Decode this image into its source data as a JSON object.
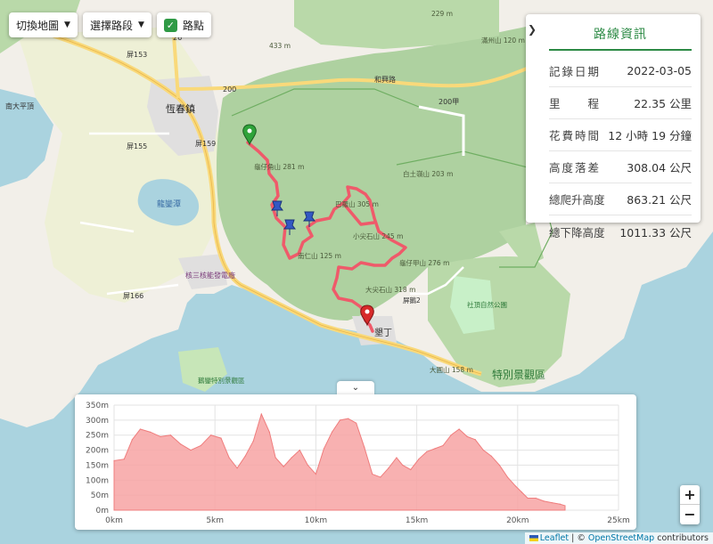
{
  "controls": {
    "switch_map": "切換地圖",
    "select_section": "選擇路段",
    "waypoint": "路點"
  },
  "info": {
    "title": "路線資訊",
    "rows": [
      {
        "label": [
          "記",
          "錄",
          "日",
          "期"
        ],
        "value": "2022-03-05"
      },
      {
        "label": [
          "里",
          "程"
        ],
        "value": "22.35 公里"
      },
      {
        "label": [
          "花",
          "費",
          "時",
          "間"
        ],
        "value": "12 小時 19 分鐘"
      },
      {
        "label": [
          "高",
          "度",
          "落",
          "差"
        ],
        "value": "308.04 公尺"
      },
      {
        "label": [
          "總",
          "爬",
          "升",
          "高",
          "度"
        ],
        "value": "863.21 公尺"
      },
      {
        "label": [
          "總",
          "下",
          "降",
          "高",
          "度"
        ],
        "value": "1011.33 公尺"
      }
    ]
  },
  "map_labels": {
    "towns": [
      "恆春鎮",
      "墾丁"
    ],
    "roads": [
      "屏153",
      "屏155",
      "屏159",
      "屏166",
      "屏174",
      "200",
      "200甲",
      "26",
      "和興路"
    ],
    "peaks": [
      "龜仔角山 281 m",
      "白土嶺山 203 m",
      "巴羅山 305 m",
      "小尖石山 245 m",
      "龜仔甲山 276 m",
      "大尖石山 318 m",
      "南仁山 125 m",
      "大圓山 158 m",
      "滿州山 120 m",
      "229 m",
      "433 m"
    ],
    "places": [
      "核三核能發電廠",
      "鵝鑾特別景觀區",
      "特別景觀區",
      "龍磐坑",
      "社頂自然公園",
      "南大平頂",
      "屏鵝2"
    ],
    "water": [
      "龍鑾潭"
    ]
  },
  "chart_data": {
    "type": "area",
    "xlabel": "",
    "ylabel": "",
    "xlim": [
      0,
      25
    ],
    "ylim": [
      0,
      350
    ],
    "x_ticks": [
      "0km",
      "5km",
      "10km",
      "15km",
      "20km",
      "25km"
    ],
    "y_ticks": [
      "0m",
      "50m",
      "100m",
      "150m",
      "200m",
      "250m",
      "300m",
      "350m"
    ],
    "grid": true,
    "color": "#f7a3a3",
    "x": [
      0,
      0.5,
      0.9,
      1.3,
      1.8,
      2.3,
      2.8,
      3.3,
      3.8,
      4.3,
      4.8,
      5.3,
      5.7,
      6.1,
      6.5,
      6.9,
      7.3,
      7.7,
      8.0,
      8.4,
      8.8,
      9.2,
      9.6,
      10.0,
      10.4,
      10.8,
      11.2,
      11.6,
      12.0,
      12.4,
      12.8,
      13.2,
      13.6,
      14.0,
      14.3,
      14.7,
      15.1,
      15.5,
      15.9,
      16.3,
      16.7,
      17.1,
      17.5,
      17.9,
      18.3,
      18.7,
      19.1,
      19.5,
      19.9,
      20.2,
      20.5,
      20.9,
      21.3,
      21.7,
      22.1,
      22.35
    ],
    "y": [
      165,
      170,
      235,
      270,
      260,
      245,
      250,
      220,
      200,
      215,
      250,
      240,
      175,
      140,
      180,
      230,
      320,
      260,
      175,
      145,
      175,
      200,
      150,
      120,
      205,
      260,
      300,
      305,
      290,
      210,
      120,
      110,
      140,
      175,
      150,
      135,
      170,
      195,
      205,
      215,
      250,
      270,
      245,
      235,
      200,
      180,
      150,
      110,
      80,
      60,
      40,
      40,
      30,
      25,
      20,
      15
    ]
  }
}
